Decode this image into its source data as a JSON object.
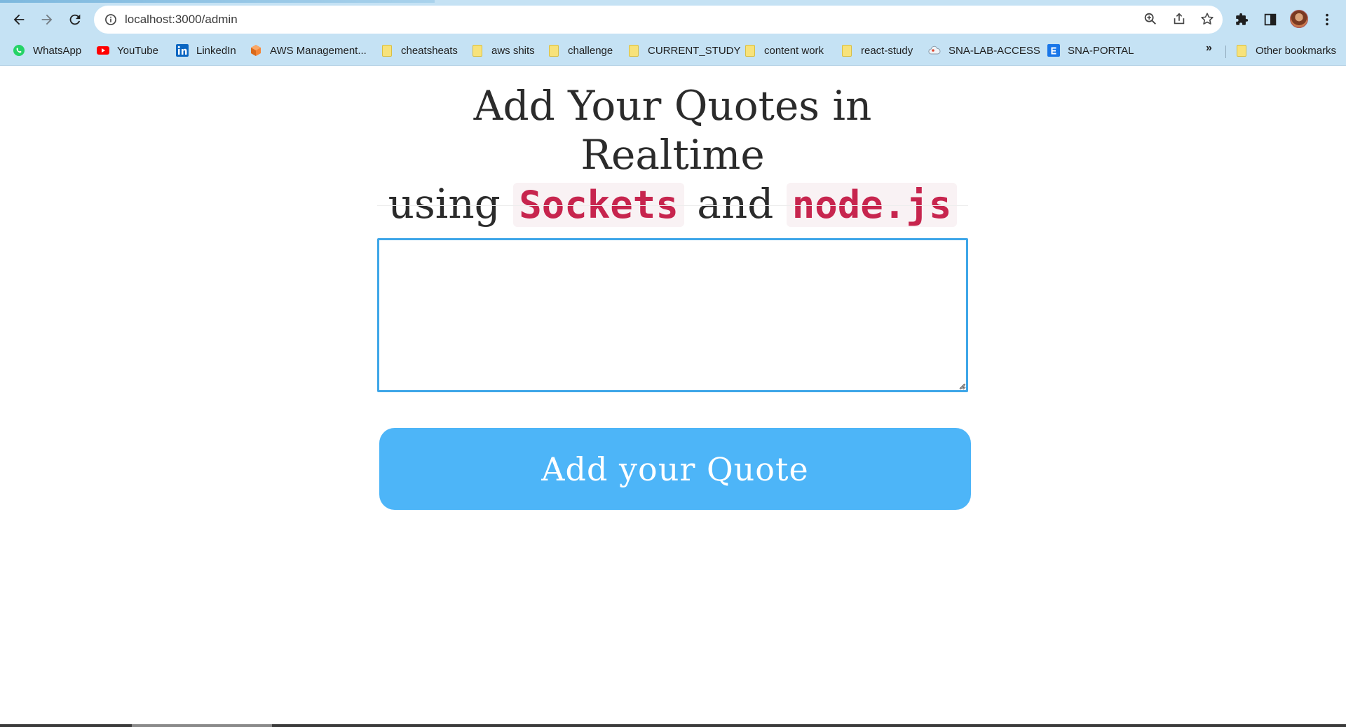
{
  "browser": {
    "url": "localhost:3000/admin",
    "bookmarks": [
      {
        "label": "WhatsApp",
        "icon": "whatsapp-icon"
      },
      {
        "label": "YouTube",
        "icon": "youtube-icon"
      },
      {
        "label": "LinkedIn",
        "icon": "linkedin-icon"
      },
      {
        "label": "AWS Management...",
        "icon": "aws-icon"
      },
      {
        "label": "cheatsheats",
        "icon": "folder-icon"
      },
      {
        "label": "aws shits",
        "icon": "folder-icon"
      },
      {
        "label": "challenge",
        "icon": "folder-icon"
      },
      {
        "label": "CURRENT_STUDY",
        "icon": "folder-icon"
      },
      {
        "label": "content work",
        "icon": "folder-icon"
      },
      {
        "label": "react-study",
        "icon": "folder-icon"
      },
      {
        "label": "SNA-LAB-ACCESS",
        "icon": "cloud-icon"
      },
      {
        "label": "SNA-PORTAL",
        "icon": "portal-icon"
      }
    ],
    "overflow_label": "»",
    "other_bookmarks": "Other bookmarks"
  },
  "page": {
    "heading": {
      "line1": "Add Your Quotes in Realtime",
      "using": "using",
      "tech1": "Sockets",
      "and": "and",
      "tech2": "node.js"
    },
    "quote_input": {
      "value": "",
      "placeholder": ""
    },
    "submit_label": "Add your Quote"
  },
  "colors": {
    "chrome": "#c5e2f4",
    "accent_button": "#4db5f8",
    "input_focus_border": "#3ea6e8",
    "code_text": "#c7254e",
    "code_bg": "#f9f2f4"
  }
}
